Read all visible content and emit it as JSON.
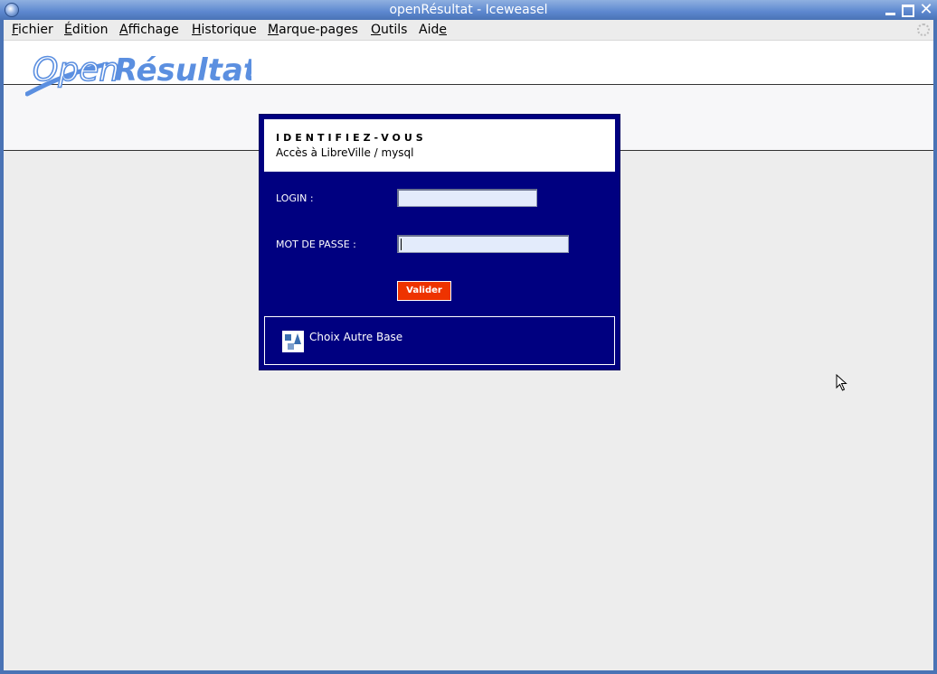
{
  "window": {
    "title": "openRésultat - Iceweasel"
  },
  "menubar": {
    "items": [
      {
        "pre": "",
        "key": "F",
        "post": "ichier"
      },
      {
        "pre": "",
        "key": "É",
        "post": "dition"
      },
      {
        "pre": "",
        "key": "A",
        "post": "ffichage"
      },
      {
        "pre": "",
        "key": "H",
        "post": "istorique"
      },
      {
        "pre": "",
        "key": "M",
        "post": "arque-pages"
      },
      {
        "pre": "",
        "key": "O",
        "post": "utils"
      },
      {
        "pre": "Aid",
        "key": "e",
        "post": ""
      }
    ]
  },
  "logo": {
    "word1": "Open",
    "word2": "Résultat"
  },
  "login": {
    "title": "IDENTIFIEZ-VOUS",
    "subtitle": "Accès à LibreVille / mysql",
    "login_label": "LOGIN :",
    "login_value": "",
    "password_label": "MOT DE PASSE :",
    "password_value": "",
    "submit_label": "Valider",
    "other_base_label": "Choix Autre Base"
  },
  "colors": {
    "panel": "#000080",
    "button": "#ee3300",
    "logo_blue": "#5b8fe0"
  }
}
